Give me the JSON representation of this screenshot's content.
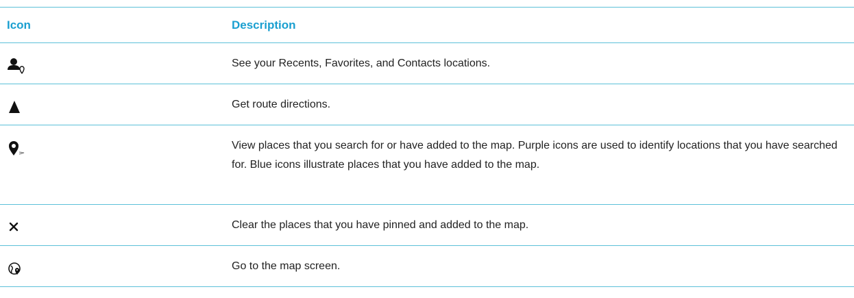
{
  "table": {
    "headers": {
      "icon": "Icon",
      "description": "Description"
    },
    "rows": [
      {
        "icon": "contact-location-icon",
        "description": "See your Recents, Favorites, and Contacts locations."
      },
      {
        "icon": "navigation-arrow-icon",
        "description": "Get route directions."
      },
      {
        "icon": "map-pin-icon",
        "description": "View places that you search for or have added to the map. Purple icons are used to identify locations that you have searched for. Blue icons illustrate places that you have added to the map."
      },
      {
        "icon": "close-icon",
        "description": "Clear the places that you have pinned and added to the map."
      },
      {
        "icon": "globe-pin-icon",
        "description": "Go to the map screen."
      }
    ]
  },
  "colors": {
    "header_text": "#1a9fd0",
    "rule": "#5bc0d8",
    "body_text": "#222222"
  }
}
